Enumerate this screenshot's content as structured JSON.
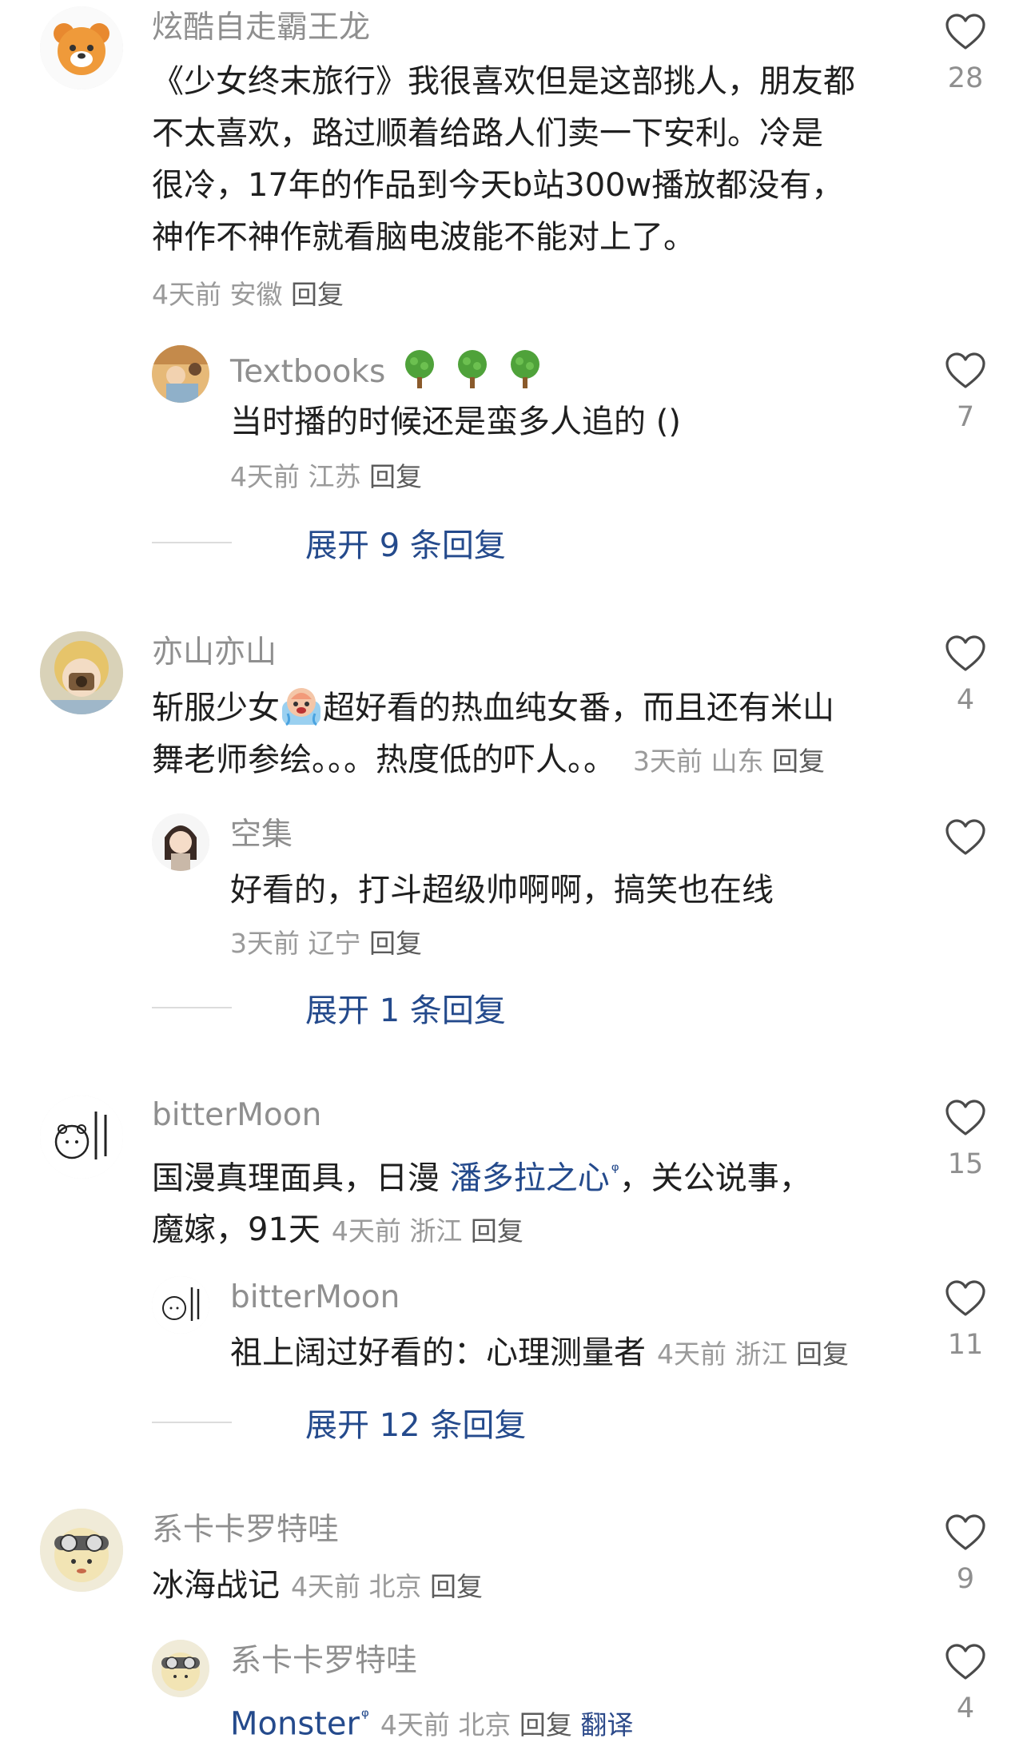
{
  "comments": [
    {
      "username": "炫酷自走霸王龙",
      "lines": [
        "《少女终末旅行》我很喜欢但是这部挑人，朋友都",
        "不太喜欢，路过顺着给路人们卖一下安利。冷是",
        "很冷，17年的作品到今天b站300w播放都没有，",
        "神作不神作就看脑电波能不能对上了。"
      ],
      "time": "4天前",
      "location": "安徽",
      "reply_label": "回复",
      "likes": "28",
      "avatar_icon": "orange-bear-avatar",
      "replies": [
        {
          "username": "Textbooks",
          "text": "当时播的时候还是蛮多人追的 ()",
          "time": "4天前",
          "location": "江苏",
          "reply_label": "回复",
          "likes": "7",
          "avatar_icon": "anime-scene-avatar",
          "badges": [
            "tree-emoji",
            "tree-emoji",
            "tree-emoji"
          ]
        }
      ],
      "expand_label": "展开 9 条回复"
    },
    {
      "username": "亦山亦山",
      "text_before_emoji": "斩服少女",
      "text_after_emoji": "超好看的热血纯女番，而且还有米山",
      "line2": "舞老师参绘。。。热度低的吓人。。",
      "time": "3天前",
      "location": "山东",
      "reply_label": "回复",
      "likes": "4",
      "avatar_icon": "girl-camera-avatar",
      "emoji_icon": "crying-emoji",
      "replies": [
        {
          "username": "空集",
          "text": "好看的，打斗超级帅啊啊，搞笑也在线",
          "time": "3天前",
          "location": "辽宁",
          "reply_label": "回复",
          "likes": "",
          "avatar_icon": "anime-character-avatar"
        }
      ],
      "expand_label": "展开 1 条回复"
    },
    {
      "username": "bitterMoon",
      "text_prefix": "国漫真理面具，日漫 ",
      "search_link": "潘多拉之心",
      "text_suffix": "，关公说事，",
      "line2": "魔嫁，91天",
      "time": "4天前",
      "location": "浙江",
      "reply_label": "回复",
      "likes": "15",
      "avatar_icon": "bear-sketch-avatar",
      "replies": [
        {
          "username": "bitterMoon",
          "text": "祖上阔过好看的：心理测量者",
          "time": "4天前",
          "location": "浙江",
          "reply_label": "回复",
          "likes": "11",
          "avatar_icon": "bear-sketch-avatar"
        }
      ],
      "expand_label": "展开 12 条回复"
    },
    {
      "username": "系卡卡罗特哇",
      "text": "冰海战记",
      "time": "4天前",
      "location": "北京",
      "reply_label": "回复",
      "likes": "9",
      "avatar_icon": "goggles-character-avatar",
      "replies": [
        {
          "username": "系卡卡罗特哇",
          "search_link": "Monster",
          "time": "4天前",
          "location": "北京",
          "reply_label": "回复",
          "translate_label": "翻译",
          "likes": "4",
          "avatar_icon": "goggles-character-avatar"
        }
      ]
    }
  ],
  "icons": {
    "like": "heart-outline-icon",
    "search_hint": "search-hint-icon"
  },
  "colors": {
    "link": "#244a8c",
    "meta": "#9a9a9a",
    "username": "#8f8f8f"
  }
}
